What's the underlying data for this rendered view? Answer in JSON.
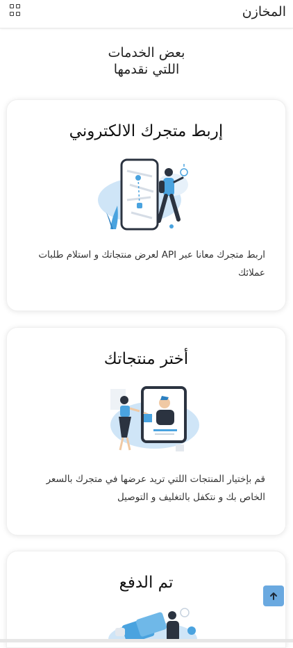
{
  "header": {
    "brand": "المخازن",
    "menu_icon": "grid-icon"
  },
  "section": {
    "title_line1": "بعض الخدمات",
    "title_line2": "اللتي نقدمها"
  },
  "cards": [
    {
      "title": "إربط متجرك الالكتروني",
      "text": "اربط متجرك معانا عبر API لعرض منتجاتك و استلام طلبات عملائك",
      "illustration": "phone-map-delivery-illustration"
    },
    {
      "title": "أختر منتجاتك",
      "text": "قم بإختيار المنتجات اللتي تريد عرضها في متجرك بالسعر الخاص بك و نتكفل بالتغليف و التوصيل",
      "illustration": "tablet-shopping-illustration"
    },
    {
      "title": "تم الدفع",
      "text": "",
      "illustration": "card-payment-illustration"
    }
  ],
  "scroll_top": {
    "icon": "arrow-up-icon"
  },
  "colors": {
    "accent": "#6aa9e0",
    "illustration_blue": "#4aa3df",
    "light_blue": "#cfe5f7"
  }
}
